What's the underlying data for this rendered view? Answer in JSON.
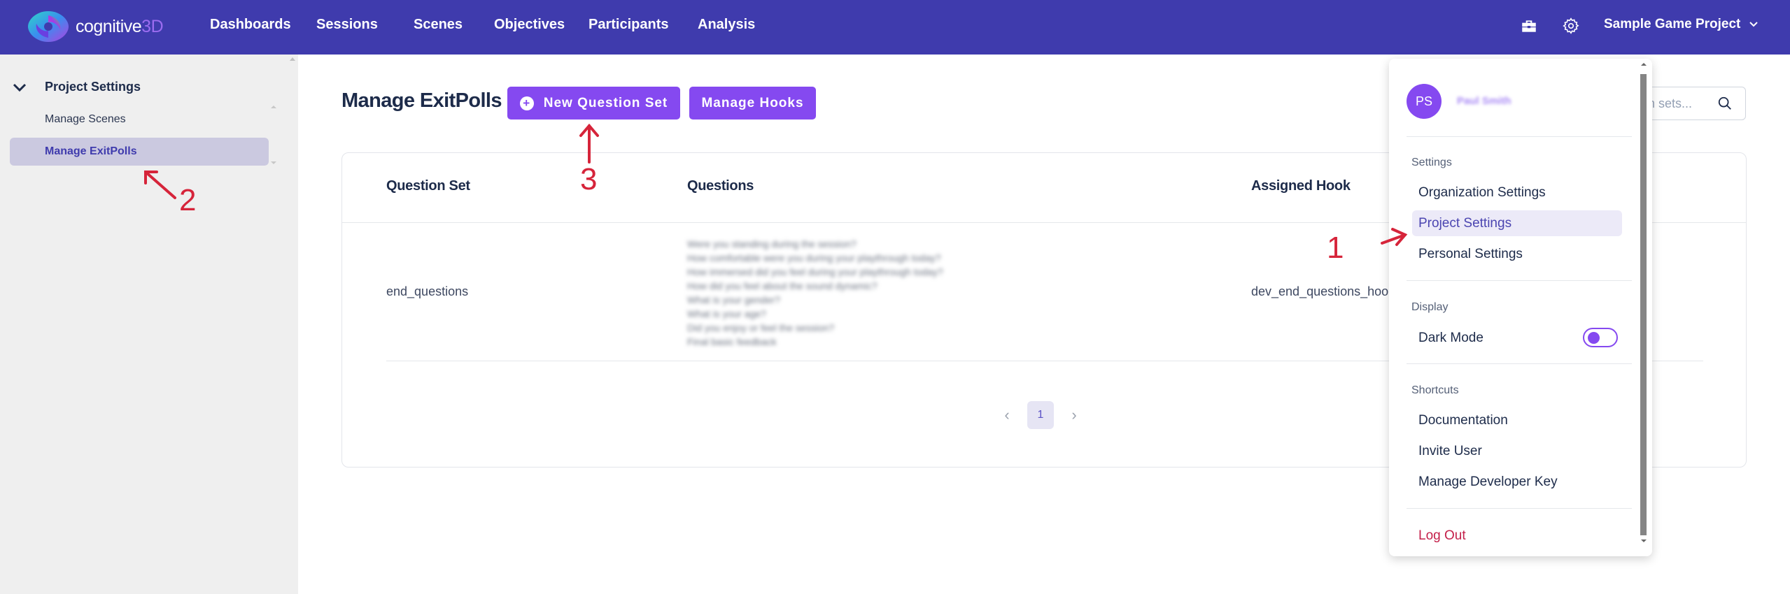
{
  "brand": {
    "name": "cognitive",
    "name_accent": "3D"
  },
  "nav": {
    "links": [
      "Dashboards",
      "Sessions",
      "Scenes",
      "Objectives",
      "Participants",
      "Analysis"
    ],
    "project_name": "Sample Game Project"
  },
  "sidebar": {
    "section_label": "Project Settings",
    "items": [
      {
        "label": "Manage Scenes",
        "active": false
      },
      {
        "label": "Manage ExitPolls",
        "active": true
      }
    ]
  },
  "main": {
    "title": "Manage ExitPolls",
    "new_button": "New Question Set",
    "hooks_button": "Manage Hooks",
    "search_placeholder": "Search question sets...",
    "search_visible_text": "n sets..."
  },
  "table": {
    "headers": [
      "Question Set",
      "Questions",
      "Assigned Hook"
    ],
    "rows": [
      {
        "question_set": "end_questions",
        "questions": [
          "Were you standing during the session?",
          "How comfortable were you during your playthrough today?",
          "How immersed did you feel during your playthrough today?",
          "How did you feel about the sound dynamic?",
          "What is your gender?",
          "What is your age?",
          "Did you enjoy or feel the session?",
          "Final basic feedback"
        ],
        "assigned_hook": "dev_end_questions_hook"
      }
    ],
    "pagination": {
      "current_page": "1"
    }
  },
  "user_menu": {
    "avatar_initials": "PS",
    "user_name": "Paul Smith",
    "settings_label": "Settings",
    "settings_items": [
      "Organization Settings",
      "Project Settings",
      "Personal Settings"
    ],
    "active_settings_item": "Project Settings",
    "display_label": "Display",
    "dark_mode_label": "Dark Mode",
    "dark_mode_on": false,
    "shortcuts_label": "Shortcuts",
    "shortcut_items": [
      "Documentation",
      "Invite User",
      "Manage Developer Key"
    ],
    "logout_label": "Log Out"
  },
  "annotations": [
    "1",
    "2",
    "3"
  ],
  "colors": {
    "nav_bg": "#3f3bad",
    "accent_purple": "#8549f0",
    "sidebar_bg": "#efefef",
    "sidebar_active_bg": "#cbc9e0",
    "logout_red": "#c4204a",
    "annotation_red": "#d6243a"
  }
}
